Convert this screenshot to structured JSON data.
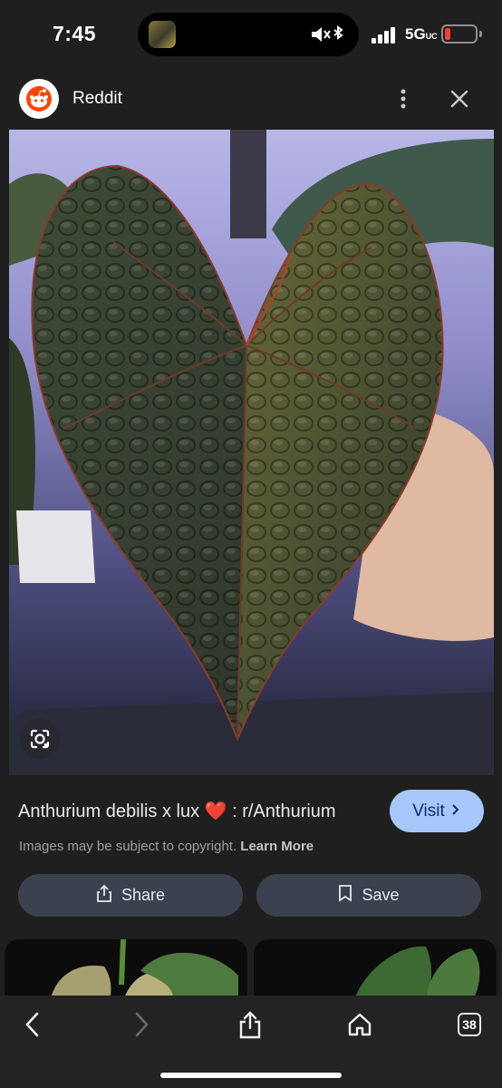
{
  "status_bar": {
    "time": "7:45",
    "network": "5G",
    "network_suffix": "UC",
    "battery_color": "#ff3b30",
    "icons": [
      "now-playing-thumbnail-icon",
      "mute-icon",
      "bluetooth-icon",
      "signal-icon",
      "battery-icon"
    ]
  },
  "header": {
    "app_name": "Reddit",
    "icons": [
      "reddit-logo-icon",
      "more-vert-icon",
      "close-icon"
    ]
  },
  "result": {
    "title": "Anthurium debilis x lux ❤️ : r/Anthurium",
    "visit_label": "Visit",
    "copyright_text": "Images may be subject to copyright.",
    "learn_more_label": "Learn More",
    "share_label": "Share",
    "save_label": "Save",
    "accent_color": "#a8c7fa"
  },
  "toolbar": {
    "tab_count": "38",
    "icons": [
      "back-icon",
      "forward-icon",
      "share-icon",
      "home-icon",
      "tabs-icon"
    ]
  }
}
